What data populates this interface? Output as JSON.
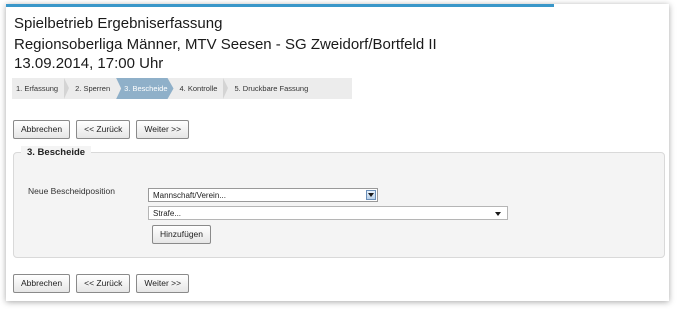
{
  "header": {
    "title": "Spielbetrieb Ergebniserfassung",
    "match": "Regionsoberliga Männer, MTV Seesen - SG Zweidorf/Bortfeld II",
    "datetime": "13.09.2014, 17:00 Uhr"
  },
  "steps": [
    {
      "label": "1. Erfassung",
      "active": false
    },
    {
      "label": "2. Sperren",
      "active": false
    },
    {
      "label": "3. Bescheide",
      "active": true
    },
    {
      "label": "4. Kontrolle",
      "active": false
    },
    {
      "label": "5. Druckbare Fassung",
      "active": false
    }
  ],
  "buttons": {
    "cancel": "Abbrechen",
    "back": "<< Zurück",
    "next": "Weiter >>"
  },
  "section": {
    "legend": "3. Bescheide",
    "field_label": "Neue Bescheidposition",
    "team_select": "Mannschaft/Verein...",
    "penalty_select": "Strafe...",
    "add_button": "Hinzufügen"
  },
  "colors": {
    "accent_line": "#3a97c9",
    "active_step": "#8fb0c9"
  }
}
